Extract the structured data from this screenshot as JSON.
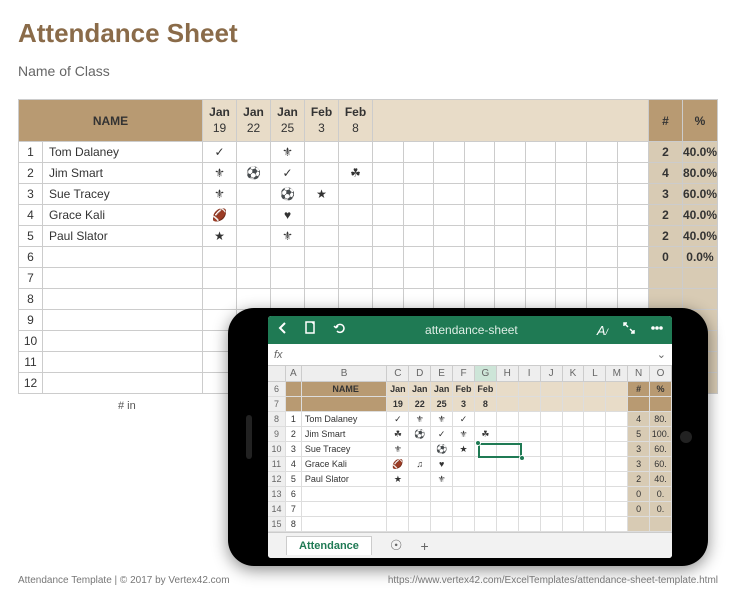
{
  "title": "Attendance Sheet",
  "subtitle": "Name of Class",
  "headers": {
    "name": "NAME",
    "count": "#",
    "percent": "%",
    "dates": [
      {
        "month": "Jan",
        "day": "19"
      },
      {
        "month": "Jan",
        "day": "22"
      },
      {
        "month": "Jan",
        "day": "25"
      },
      {
        "month": "Feb",
        "day": "3"
      },
      {
        "month": "Feb",
        "day": "8"
      }
    ]
  },
  "rows": [
    {
      "idx": "1",
      "name": "Tom Dalaney",
      "marks": [
        "✓",
        "",
        "⚜",
        "",
        ""
      ],
      "count": "2",
      "pct": "40.0%"
    },
    {
      "idx": "2",
      "name": "Jim Smart",
      "marks": [
        "⚜",
        "⚽",
        "✓",
        "",
        "☘"
      ],
      "count": "4",
      "pct": "80.0%"
    },
    {
      "idx": "3",
      "name": "Sue Tracey",
      "marks": [
        "⚜",
        "",
        "⚽",
        "★",
        ""
      ],
      "count": "3",
      "pct": "60.0%"
    },
    {
      "idx": "4",
      "name": "Grace Kali",
      "marks": [
        "🏈",
        "",
        "♥",
        "",
        ""
      ],
      "count": "2",
      "pct": "40.0%"
    },
    {
      "idx": "5",
      "name": "Paul Slator",
      "marks": [
        "★",
        "",
        "⚜",
        "",
        ""
      ],
      "count": "2",
      "pct": "40.0%"
    },
    {
      "idx": "6",
      "name": "",
      "marks": [
        "",
        "",
        "",
        "",
        ""
      ],
      "count": "0",
      "pct": "0.0%"
    },
    {
      "idx": "7",
      "name": "",
      "marks": [
        "",
        "",
        "",
        "",
        ""
      ],
      "count": "",
      "pct": ""
    },
    {
      "idx": "8",
      "name": "",
      "marks": [
        "",
        "",
        "",
        "",
        ""
      ],
      "count": "",
      "pct": ""
    },
    {
      "idx": "9",
      "name": "",
      "marks": [
        "",
        "",
        "",
        "",
        ""
      ],
      "count": "",
      "pct": ""
    },
    {
      "idx": "10",
      "name": "",
      "marks": [
        "",
        "",
        "",
        "",
        ""
      ],
      "count": "",
      "pct": ""
    },
    {
      "idx": "11",
      "name": "",
      "marks": [
        "",
        "",
        "",
        "",
        ""
      ],
      "count": "",
      "pct": ""
    },
    {
      "idx": "12",
      "name": "",
      "marks": [
        "",
        "",
        "",
        "",
        ""
      ],
      "count": "",
      "pct": ""
    }
  ],
  "footnote": "# in",
  "footer": {
    "left": "Attendance Template | © 2017 by Vertex42.com",
    "right": "https://www.vertex42.com/ExcelTemplates/attendance-sheet-template.html"
  },
  "phone": {
    "filename": "attendance-sheet",
    "fx_label": "fx",
    "tab": "Attendance",
    "cols": [
      "A",
      "B",
      "C",
      "D",
      "E",
      "F",
      "G",
      "H",
      "I",
      "J",
      "K",
      "L",
      "M",
      "N",
      "O"
    ],
    "selected_col": "G",
    "rows": [
      {
        "rn": "6",
        "type": "hdr1"
      },
      {
        "rn": "7",
        "type": "hdr2"
      },
      {
        "rn": "8",
        "idx": "1",
        "name": "Tom Dalaney",
        "marks": [
          "✓",
          "⚜",
          "⚜",
          "✓",
          ""
        ],
        "count": "4",
        "pct": "80."
      },
      {
        "rn": "9",
        "idx": "2",
        "name": "Jim Smart",
        "marks": [
          "☘",
          "⚽",
          "✓",
          "⚜",
          "☘"
        ],
        "count": "5",
        "pct": "100."
      },
      {
        "rn": "10",
        "idx": "3",
        "name": "Sue Tracey",
        "marks": [
          "⚜",
          "",
          "⚽",
          "★",
          ""
        ],
        "count": "3",
        "pct": "60."
      },
      {
        "rn": "11",
        "idx": "4",
        "name": "Grace Kali",
        "marks": [
          "🏈",
          "♫",
          "♥",
          "",
          ""
        ],
        "count": "3",
        "pct": "60."
      },
      {
        "rn": "12",
        "idx": "5",
        "name": "Paul Slator",
        "marks": [
          "★",
          "",
          "⚜",
          "",
          ""
        ],
        "count": "2",
        "pct": "40."
      },
      {
        "rn": "13",
        "idx": "6",
        "name": "",
        "marks": [
          "",
          "",
          "",
          "",
          ""
        ],
        "count": "0",
        "pct": "0."
      },
      {
        "rn": "14",
        "idx": "7",
        "name": "",
        "marks": [
          "",
          "",
          "",
          "",
          ""
        ],
        "count": "0",
        "pct": "0."
      },
      {
        "rn": "15",
        "idx": "8",
        "name": "",
        "marks": [
          "",
          "",
          "",
          "",
          ""
        ],
        "count": "",
        "pct": ""
      }
    ]
  }
}
